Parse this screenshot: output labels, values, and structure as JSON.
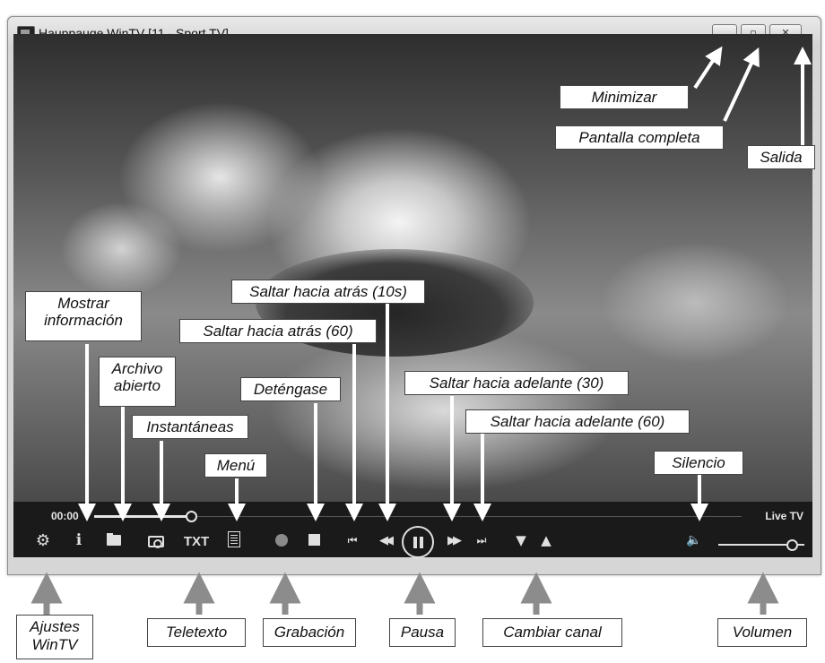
{
  "window": {
    "title": "Hauppauge WinTV [11 - Sport TV]",
    "buttons": {
      "minimize": "minimize-icon",
      "maximize": "maximize-icon",
      "close": "close-icon"
    }
  },
  "player": {
    "time": "00:00",
    "status": "Live TV",
    "teletext_label": "TXT",
    "seek_fraction": 0.15,
    "volume_fraction": 0.85
  },
  "callouts": {
    "minimizar": "Minimizar",
    "pantalla_completa": "Pantalla completa",
    "salida": "Salida",
    "mostrar_informacion_1": "Mostrar",
    "mostrar_informacion_2": "información",
    "archivo_abierto_1": "Archivo",
    "archivo_abierto_2": "abierto",
    "instantaneas": "Instantáneas",
    "menu": "Menú",
    "detengase": "Deténgase",
    "saltar_atras_10": "Saltar hacia atrás (10s)",
    "saltar_atras_60": "Saltar hacia atrás (60)",
    "saltar_adelante_30": "Saltar hacia adelante (30)",
    "saltar_adelante_60": "Saltar hacia adelante (60)",
    "silencio": "Silencio",
    "ajustes_1": "Ajustes",
    "ajustes_2": "WinTV",
    "teletexto": "Teletexto",
    "grabacion": "Grabación",
    "pausa": "Pausa",
    "cambiar_canal": "Cambiar canal",
    "volumen": "Volumen"
  },
  "colors": {
    "control_bar": "#1a1a1a",
    "control_icons": "#e0e0e0",
    "callout_arrow": "#ffffff",
    "bottom_arrow": "#8c8c8c"
  }
}
